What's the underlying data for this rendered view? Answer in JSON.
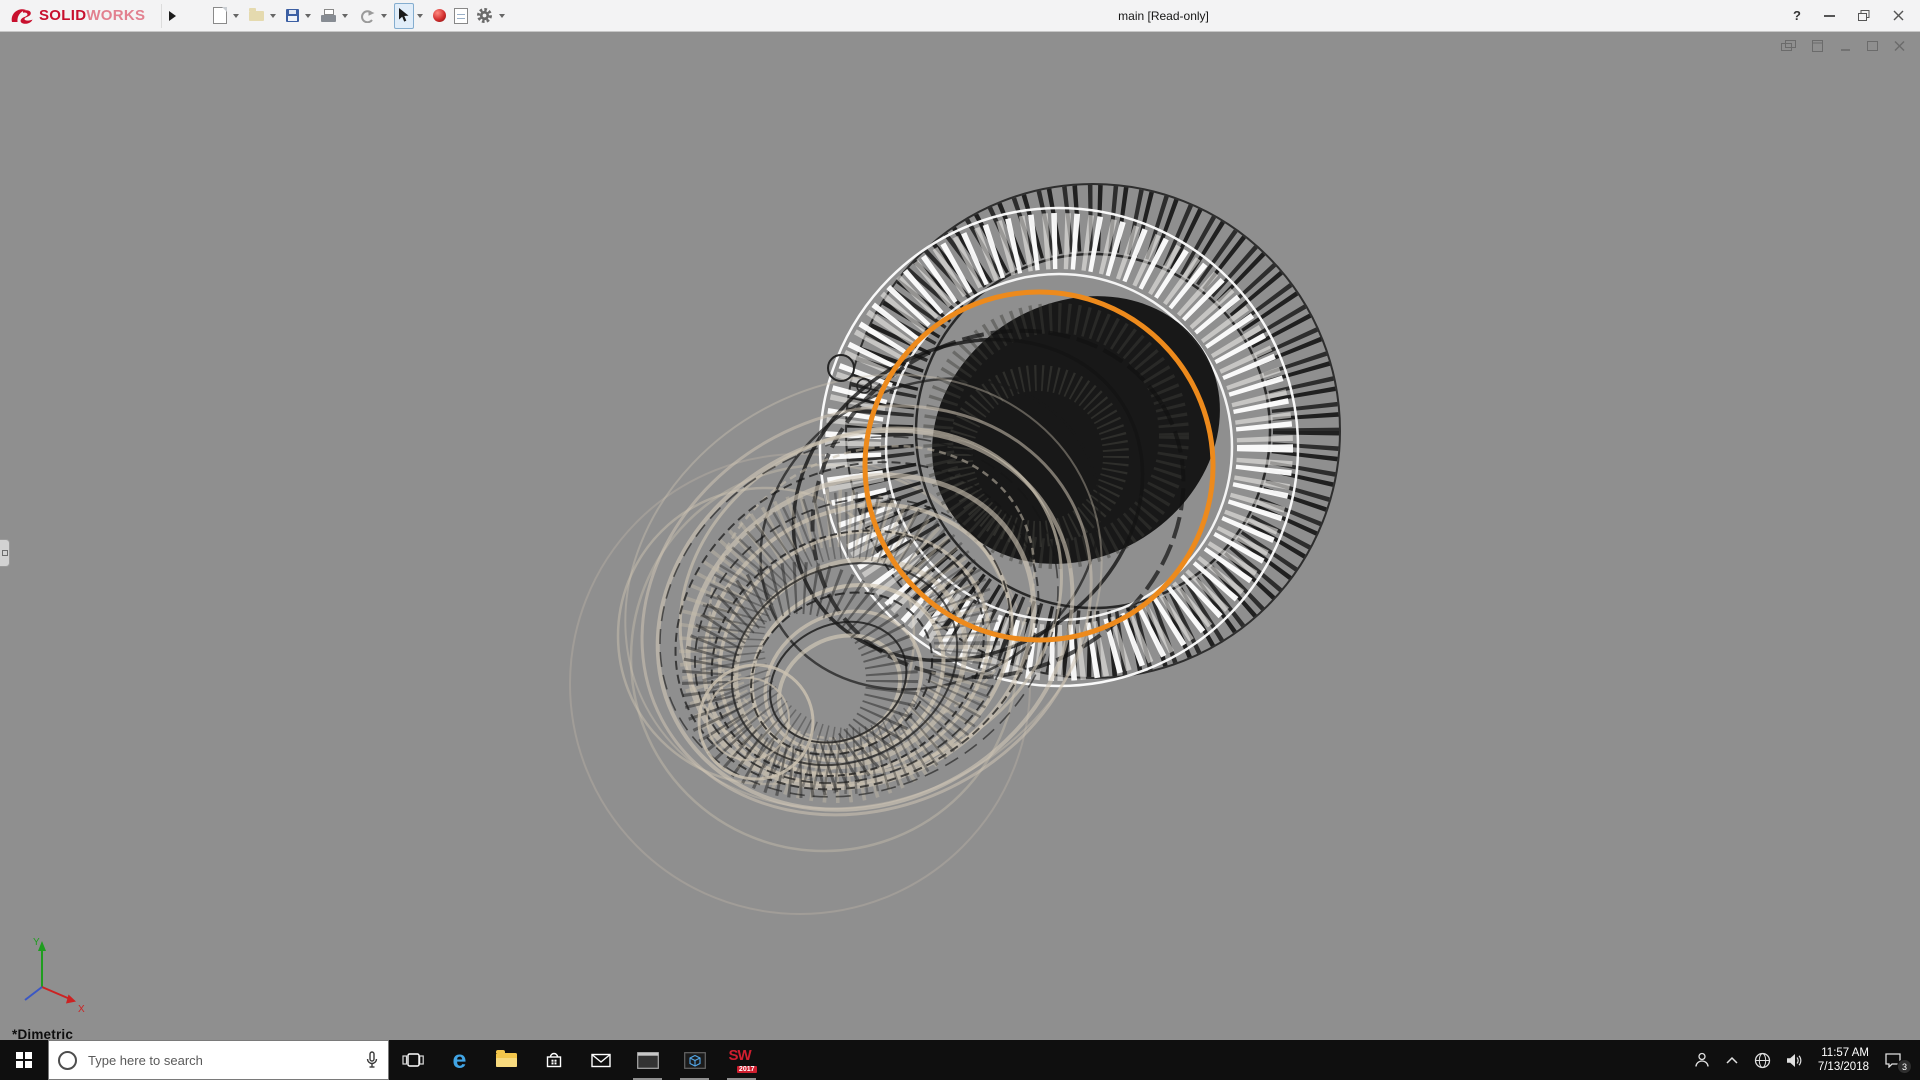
{
  "titlebar": {
    "logo_solid": "SOLID",
    "logo_works": "WORKS",
    "document_title": "main [Read-only]",
    "help_glyph": "?",
    "toolbar_icons": [
      "new-document-icon",
      "publish-icon",
      "save-icon",
      "print-icon",
      "undo-icon",
      "select-cursor-icon",
      "appearance-sphere-icon",
      "design-binder-icon",
      "options-gear-icon"
    ]
  },
  "viewport": {
    "orientation_label": "*Dimetric",
    "axis_x_label": "X",
    "axis_y_label": "Y",
    "highlight_color": "#ED8A1C",
    "background_color": "#8F8F8F"
  },
  "taskbar": {
    "search_placeholder": "Type here to search",
    "edge_letter": "e",
    "sw_letters": "SW",
    "sw_year": "2017",
    "clock_time": "11:57 AM",
    "clock_date": "7/13/2018",
    "notification_badge": "3"
  },
  "colors": {
    "titlebar_bg": "#F3F3F4",
    "taskbar_bg": "#0F0F0F",
    "logo_red": "#C8102E",
    "accent_orange": "#ED8A1C"
  }
}
